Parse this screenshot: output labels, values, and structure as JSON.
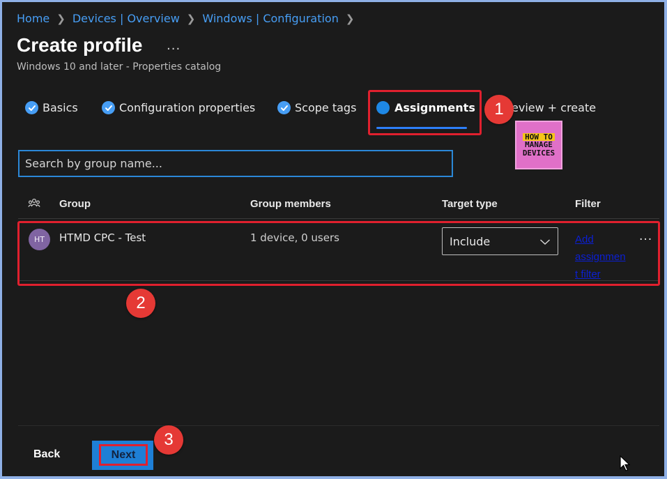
{
  "breadcrumb": [
    "Home",
    "Devices | Overview",
    "Windows | Configuration"
  ],
  "page": {
    "title": "Create profile",
    "more": "...",
    "subtitle": "Windows 10 and later - Properties catalog"
  },
  "tabs": [
    {
      "label": "Basics",
      "state": "complete"
    },
    {
      "label": "Configuration properties",
      "state": "complete"
    },
    {
      "label": "Scope tags",
      "state": "complete"
    },
    {
      "label": "Assignments",
      "state": "active"
    },
    {
      "label": "Review + create",
      "state": "pending",
      "visible_label": "eview + create"
    }
  ],
  "callouts": [
    "1",
    "2",
    "3"
  ],
  "logo": {
    "line1": "HOW TO",
    "line2": "MANAGE",
    "line3": "DEVICES"
  },
  "search": {
    "placeholder": "Search by group name..."
  },
  "table": {
    "headers": {
      "group": "Group",
      "members": "Group members",
      "target_type": "Target type",
      "filter": "Filter"
    },
    "rows": [
      {
        "initials": "HT",
        "group": "HTMD CPC - Test",
        "members": "1 device, 0 users",
        "target_type": "Include",
        "filter": "Add assignment filter",
        "filter_lines": [
          "Add",
          "assignmen",
          "t filter"
        ],
        "more": "..."
      }
    ]
  },
  "footer": {
    "back": "Back",
    "next": "Next"
  },
  "colors": {
    "accent": "#479ef5",
    "highlight": "#e0202e",
    "background": "#1b1b1b"
  }
}
